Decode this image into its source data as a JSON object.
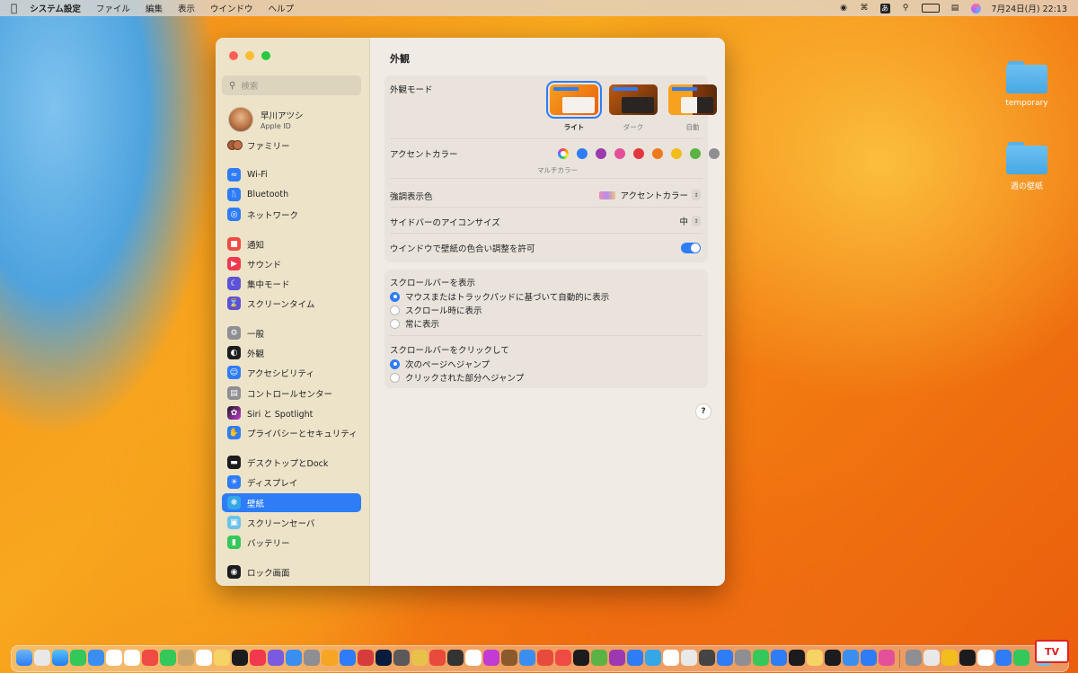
{
  "menubar": {
    "app_name": "システム設定",
    "items": [
      "ファイル",
      "編集",
      "表示",
      "ウインドウ",
      "ヘルプ"
    ],
    "ime_label": "あ",
    "datetime": "7月24日(月)  22:13"
  },
  "desktop": {
    "folders": [
      {
        "label": "temporary"
      },
      {
        "label": "週の壁紙"
      }
    ]
  },
  "sidebar": {
    "search_placeholder": "検索",
    "account": {
      "name": "早川アツシ",
      "sub": "Apple ID"
    },
    "family_label": "ファミリー",
    "items": [
      {
        "label": "Wi-Fi",
        "icon": "wifi-icon",
        "color": "#2e7cf6"
      },
      {
        "label": "Bluetooth",
        "icon": "bluetooth-icon",
        "color": "#2e7cf6"
      },
      {
        "label": "ネットワーク",
        "icon": "globe-icon",
        "color": "#2e7cf6"
      },
      {
        "label": "通知",
        "icon": "bell-icon",
        "color": "#f04a44"
      },
      {
        "label": "サウンド",
        "icon": "speaker-icon",
        "color": "#f0384e"
      },
      {
        "label": "集中モード",
        "icon": "moon-icon",
        "color": "#5b52d6"
      },
      {
        "label": "スクリーンタイム",
        "icon": "hourglass-icon",
        "color": "#5b52d6"
      },
      {
        "label": "一般",
        "icon": "gear-icon",
        "color": "#8e8e93"
      },
      {
        "label": "外観",
        "icon": "appearance-icon",
        "color": "#1c1c1e"
      },
      {
        "label": "アクセシビリティ",
        "icon": "accessibility-icon",
        "color": "#2e7cf6"
      },
      {
        "label": "コントロールセンター",
        "icon": "control-center-icon",
        "color": "#8e8e93"
      },
      {
        "label": "Siri と Spotlight",
        "icon": "siri-icon",
        "color": "#c23bd4"
      },
      {
        "label": "プライバシーとセキュリティ",
        "icon": "hand-icon",
        "color": "#2e7cf6"
      },
      {
        "label": "デスクトップとDock",
        "icon": "dock-icon",
        "color": "#1c1c1e"
      },
      {
        "label": "ディスプレイ",
        "icon": "display-icon",
        "color": "#2e7cf6"
      },
      {
        "label": "壁紙",
        "icon": "wallpaper-icon",
        "color": "#35a7e8"
      },
      {
        "label": "スクリーンセーバ",
        "icon": "screensaver-icon",
        "color": "#6cc2e8"
      },
      {
        "label": "バッテリー",
        "icon": "battery-icon",
        "color": "#34c759"
      },
      {
        "label": "ロック画面",
        "icon": "lock-icon",
        "color": "#1c1c1e"
      }
    ]
  },
  "content": {
    "title": "外観",
    "appearance": {
      "label": "外観モード",
      "options": [
        {
          "label": "ライト",
          "selected": true
        },
        {
          "label": "ダーク",
          "selected": false
        },
        {
          "label": "自動",
          "selected": false
        }
      ]
    },
    "accent": {
      "label": "アクセントカラー",
      "caption": "マルチカラー",
      "colors": [
        "multicolor",
        "#2e7cf6",
        "#9b3ab0",
        "#e3509a",
        "#e3373f",
        "#ee7a1c",
        "#f2be1e",
        "#5bb343",
        "#8e8e93"
      ]
    },
    "highlight": {
      "label": "強調表示色",
      "value": "アクセントカラー"
    },
    "sidebar_icon_size": {
      "label": "サイドバーのアイコンサイズ",
      "value": "中"
    },
    "tinting": {
      "label": "ウインドウで壁紙の色合い調整を許可",
      "enabled": true
    },
    "scrollbars": {
      "label": "スクロールバーを表示",
      "options": [
        {
          "label": "マウスまたはトラックパッドに基づいて自動的に表示",
          "selected": true
        },
        {
          "label": "スクロール時に表示",
          "selected": false
        },
        {
          "label": "常に表示",
          "selected": false
        }
      ]
    },
    "click_scrollbar": {
      "label": "スクロールバーをクリックして",
      "options": [
        {
          "label": "次のページへジャンプ",
          "selected": true
        },
        {
          "label": "クリックされた部分へジャンプ",
          "selected": false
        }
      ]
    },
    "help_label": "?"
  },
  "badge": {
    "label": "TV"
  }
}
